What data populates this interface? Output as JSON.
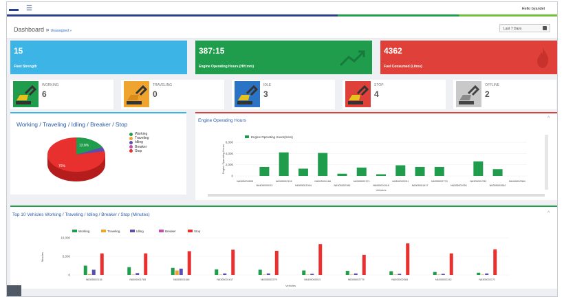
{
  "header": {
    "menu_icon": "☰",
    "user": "Hello byandel"
  },
  "breadcrumb": {
    "title": "Dashboard »",
    "sub": "Unassigned »"
  },
  "date_filter": {
    "value": "Last 7 Days",
    "icon": "calendar-icon"
  },
  "kpis": [
    {
      "value": "15",
      "label": "Fleet Strength",
      "color": "#3db4e6"
    },
    {
      "value": "387:15",
      "label": "Engine Operating Hours (HH:mm)",
      "color": "#1f9d4c",
      "icon": "trend-arrow-icon"
    },
    {
      "value": "4362",
      "label": "Fuel Consumed (Litres)",
      "color": "#e0403a",
      "icon": "flame-icon"
    }
  ],
  "statuses": [
    {
      "label": "WORKING",
      "value": "6",
      "color": "#1f9d4c"
    },
    {
      "label": "TRAVELING",
      "value": "0",
      "color": "#f0a430"
    },
    {
      "label": "IDLE",
      "value": "3",
      "color": "#2b73c4"
    },
    {
      "label": "STOP",
      "value": "4",
      "color": "#e0403a"
    },
    {
      "label": "OFFLINE",
      "value": "2",
      "color": "#bbbbbb"
    }
  ],
  "pie": {
    "title": "Working / Traveling / Idling / Breaker / Stop",
    "legend": [
      {
        "name": "Working",
        "color": "#1f9d4c"
      },
      {
        "name": "Traveling",
        "color": "#f0a430"
      },
      {
        "name": "Idling",
        "color": "#5a4fb0"
      },
      {
        "name": "Breaker",
        "color": "#c84bb0"
      },
      {
        "name": "Stop",
        "color": "#e8302f"
      }
    ],
    "labels": {
      "working": "13.8%",
      "stop": "76%"
    }
  },
  "engine": {
    "title": "Engine Operating Hours",
    "chev": "^"
  },
  "top10": {
    "title": "Top 10 Vehicles Working / Traveling / Idling / Breaker / Stop (Minutes)",
    "chev": "^"
  },
  "chart_data": [
    {
      "type": "bar",
      "title": "",
      "legend": [
        "Engine Operating Hours(mins)"
      ],
      "ylabel": "Engine Operating Hours",
      "xlabel": "Vehicles",
      "ylim": [
        0,
        6000
      ],
      "yticks": [
        "6,000",
        "4,000",
        "2,000",
        "0"
      ],
      "categories": [
        "N6305004505",
        "N6405000013",
        "N6305002134",
        "N6305001394",
        "N6305001166",
        "N6305002165",
        "N6305002171",
        "N6405002416",
        "N6305002291",
        "N6305001617",
        "N6305002779",
        "N6305002051",
        "N6305001783",
        "N6305002062",
        "N6405002384"
      ],
      "values": [
        0,
        1600,
        4200,
        1300,
        4100,
        400,
        1500,
        300,
        1900,
        1600,
        1600,
        0,
        2600,
        1200,
        0
      ]
    },
    {
      "type": "bar",
      "title": "",
      "ylabel": "Minutes",
      "xlabel": "Vehicles",
      "ylim": [
        0,
        10000
      ],
      "yticks": [
        "10,000",
        "5,000",
        "0"
      ],
      "categories": [
        "N6305002134",
        "N6305001783",
        "N6305001166",
        "N6305001617",
        "N6305002279",
        "N6405000013",
        "N6305002779",
        "N6305002384",
        "N6305002242",
        "N6305002171"
      ],
      "series": [
        {
          "name": "Working",
          "color": "#1f9d4c",
          "values": [
            2500,
            2100,
            1900,
            1500,
            1400,
            1200,
            1100,
            1000,
            800,
            600
          ]
        },
        {
          "name": "Traveling",
          "color": "#f0a430",
          "values": [
            200,
            100,
            1200,
            100,
            100,
            100,
            100,
            100,
            100,
            100
          ]
        },
        {
          "name": "Idling",
          "color": "#5a4fb0",
          "values": [
            1400,
            500,
            1700,
            400,
            400,
            300,
            400,
            300,
            300,
            400
          ]
        },
        {
          "name": "Breaker",
          "color": "#c84bb0",
          "values": [
            0,
            0,
            0,
            0,
            0,
            0,
            0,
            0,
            0,
            0
          ]
        },
        {
          "name": "Stop",
          "color": "#e8302f",
          "values": [
            5800,
            5800,
            6400,
            6800,
            6500,
            8300,
            5400,
            8500,
            5800,
            6900
          ]
        }
      ]
    }
  ]
}
